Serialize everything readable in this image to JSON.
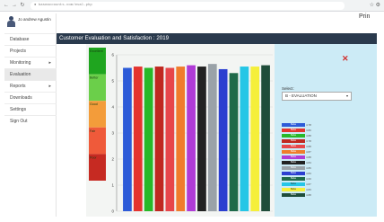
{
  "browser": {
    "url": "● baseaccounts.com/eval.php",
    "back_icon": "arrow-left-icon",
    "forward_icon": "arrow-right-icon",
    "reload_icon": "reload-icon",
    "menu_glyphs": "☆  ⚙"
  },
  "sidebar": {
    "user_name": "Jo andrew Agustin",
    "items": [
      {
        "label": "Database",
        "arrow": ""
      },
      {
        "label": "Projects",
        "arrow": ""
      },
      {
        "label": "Monitoring",
        "arrow": "▸"
      },
      {
        "label": "Evaluation",
        "arrow": ""
      },
      {
        "label": "Reports",
        "arrow": "▸"
      },
      {
        "label": "Downloads",
        "arrow": ""
      },
      {
        "label": "Settings",
        "arrow": ""
      },
      {
        "label": "Sign Out",
        "arrow": ""
      }
    ],
    "active_index": 3
  },
  "main": {
    "title": "Customer Evaluation and Satisfaction : 2019",
    "right_text": "Prin"
  },
  "panel": {
    "close_glyph": "✕",
    "select_label": "Select:",
    "select_value": "B - EVALUATION",
    "chevron": "▾"
  },
  "scale_bands": [
    {
      "label": "Excellent",
      "color": "#1fa51f"
    },
    {
      "label": "Better",
      "color": "#6bcf4a"
    },
    {
      "label": "Good",
      "color": "#f39c3a"
    },
    {
      "label": "Fair",
      "color": "#ef5a3a"
    },
    {
      "label": "Poor",
      "color": "#c62a22"
    }
  ],
  "chart_data": {
    "type": "bar",
    "ylim": [
      0,
      6
    ],
    "yticks": [
      "0",
      "1",
      "2",
      "3",
      "4",
      "5",
      "6"
    ],
    "grid": true,
    "series": [
      {
        "color": "#2d5bd8",
        "value": 5.5
      },
      {
        "color": "#e5342f",
        "value": 5.55
      },
      {
        "color": "#28b828",
        "value": 5.5
      },
      {
        "color": "#c02820",
        "value": 5.55
      },
      {
        "color": "#e7464a",
        "value": 5.5
      },
      {
        "color": "#f07c2c",
        "value": 5.55
      },
      {
        "color": "#b03bd6",
        "value": 5.6
      },
      {
        "color": "#222222",
        "value": 5.55
      },
      {
        "color": "#9aa2a8",
        "value": 5.65
      },
      {
        "color": "#2b3fd0",
        "value": 5.45
      },
      {
        "color": "#1e6a4a",
        "value": 5.3
      },
      {
        "color": "#25c6e6",
        "value": 5.55
      },
      {
        "color": "#f5ef3a",
        "value": 5.55
      },
      {
        "color": "#1f4d3a",
        "value": 5.6
      }
    ]
  },
  "legend": [
    {
      "label": "Bebe",
      "value": "4.78",
      "color": "#2d5bd8"
    },
    {
      "label": "Bebe",
      "value": "4.80",
      "color": "#e5342f"
    },
    {
      "label": "Bebe",
      "value": "4.88",
      "color": "#28b828"
    },
    {
      "label": "Bebe",
      "value": "4.78",
      "color": "#c02820"
    },
    {
      "label": "Bebe",
      "value": "4.88",
      "color": "#e7464a"
    },
    {
      "label": "Bebe",
      "value": "4.87",
      "color": "#f07c2c"
    },
    {
      "label": "Bebe",
      "value": "4.88",
      "color": "#b03bd6"
    },
    {
      "label": "Bebe",
      "value": "4.84",
      "color": "#222222"
    },
    {
      "label": "Bebe",
      "value": "4.86",
      "color": "#9aa2a8"
    },
    {
      "label": "Bebe",
      "value": "4.83",
      "color": "#2b3fd0"
    },
    {
      "label": "Bebe",
      "value": "4.60",
      "color": "#1e6a4a"
    },
    {
      "label": "Bebe",
      "value": "4.87",
      "color": "#25c6e6"
    },
    {
      "label": "Bebe",
      "value": "4.83",
      "color": "#f5ef3a"
    },
    {
      "label": "Bebe",
      "value": "4.88",
      "color": "#1f4d3a"
    }
  ]
}
